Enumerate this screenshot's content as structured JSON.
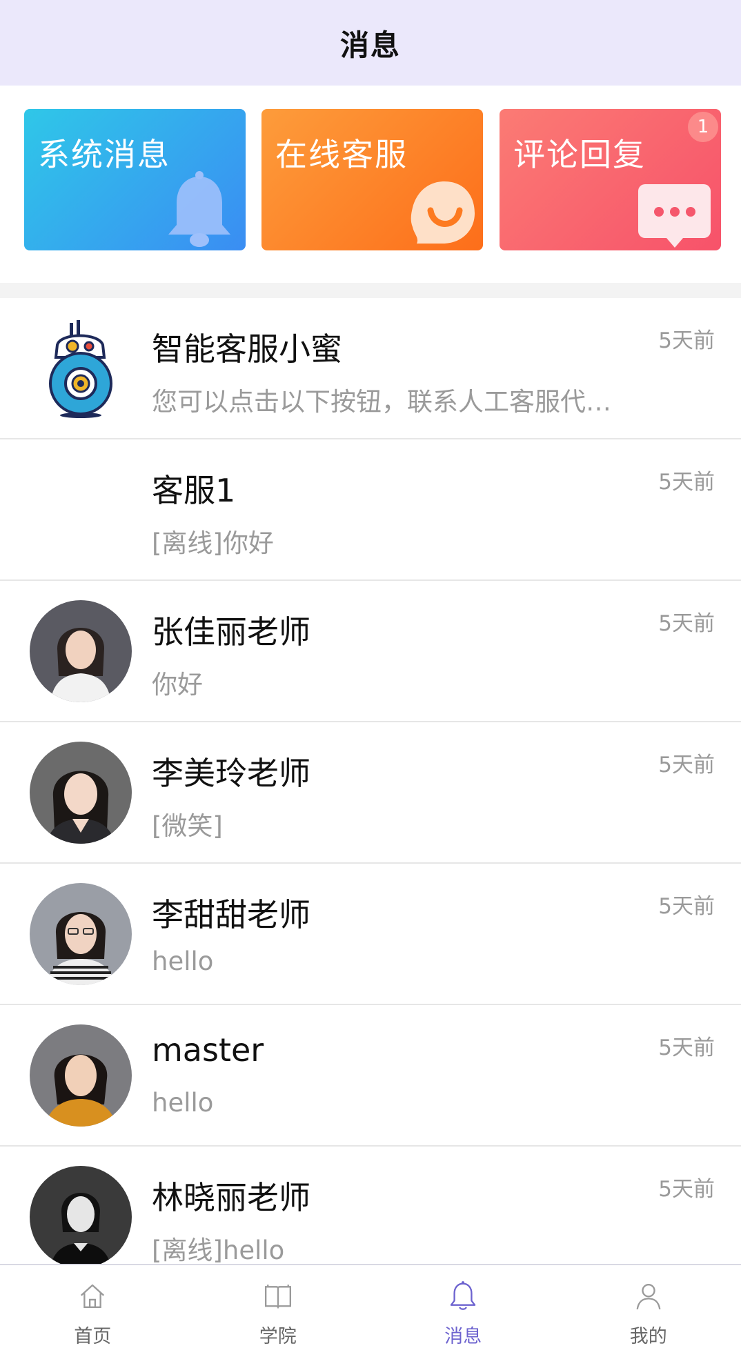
{
  "header": {
    "title": "消息"
  },
  "cards": [
    {
      "label": "系统消息",
      "icon": "bell-icon"
    },
    {
      "label": "在线客服",
      "icon": "smile-chat-icon"
    },
    {
      "label": "评论回复",
      "icon": "comment-dots-icon",
      "badge": "1"
    }
  ],
  "conversations": [
    {
      "name": "智能客服小蜜",
      "preview": "您可以点击以下按钮，联系人工客服代…",
      "time": "5天前"
    },
    {
      "name": "客服1",
      "preview": "[离线]你好",
      "time": "5天前"
    },
    {
      "name": "张佳丽老师",
      "preview": "你好",
      "time": "5天前"
    },
    {
      "name": "李美玲老师",
      "preview": "[微笑]",
      "time": "5天前"
    },
    {
      "name": "李甜甜老师",
      "preview": "hello",
      "time": "5天前"
    },
    {
      "name": "master",
      "preview": "hello",
      "time": "5天前"
    },
    {
      "name": "林晓丽老师",
      "preview": "[离线]hello",
      "time": "5天前"
    }
  ],
  "tabbar": {
    "items": [
      {
        "label": "首页",
        "icon": "home-icon"
      },
      {
        "label": "学院",
        "icon": "book-icon"
      },
      {
        "label": "消息",
        "icon": "bell-icon",
        "active": true
      },
      {
        "label": "我的",
        "icon": "user-icon"
      }
    ]
  },
  "colors": {
    "header_bg": "#ebe8fb",
    "accent": "#6d63cf",
    "system_card": "#3a8df3",
    "service_card": "#fd6e1a",
    "comment_card": "#f7526a"
  }
}
